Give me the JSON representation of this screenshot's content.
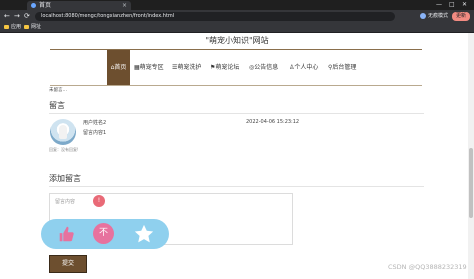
{
  "browser": {
    "tab_title": "首页",
    "tab_close": "×",
    "url": "localhost:8080/mengc/tongxianzhen/front/index.html",
    "profile_label": "无痕模式",
    "update_label": "更新",
    "back": "←",
    "forward": "→",
    "reload": "⟳",
    "win_min": "—",
    "win_max": "□",
    "win_close": "✕"
  },
  "bookmarks": [
    {
      "label": "应用"
    },
    {
      "label": "网址"
    }
  ],
  "site": {
    "title": "\"萌宠小知识\"网站"
  },
  "nav": {
    "home": "首页",
    "items": [
      {
        "label": "萌宠专区"
      },
      {
        "label": "萌宠洗护"
      },
      {
        "label": "萌宠论坛"
      },
      {
        "label": "公告信息"
      },
      {
        "label": "个人中心"
      },
      {
        "label": "后台管理"
      }
    ]
  },
  "cut_text": "未留言…",
  "messages": {
    "section_title": "留言",
    "avatar_caption": "回复：没有回复!",
    "items": [
      {
        "user": "用户姓名2",
        "date": "2022-04-06 15:23:12",
        "content": "留言内容1"
      }
    ]
  },
  "add_message": {
    "title": "添加留言",
    "placeholder": "留言内容",
    "submit_label": "提交"
  },
  "floating": {
    "mid_label": "不"
  },
  "watermark": "CSDN @QQ3888232319",
  "colors": {
    "brand_brown": "#6d4f2f",
    "float_bar": "#8fd0ee",
    "pink": "#e7729e"
  }
}
